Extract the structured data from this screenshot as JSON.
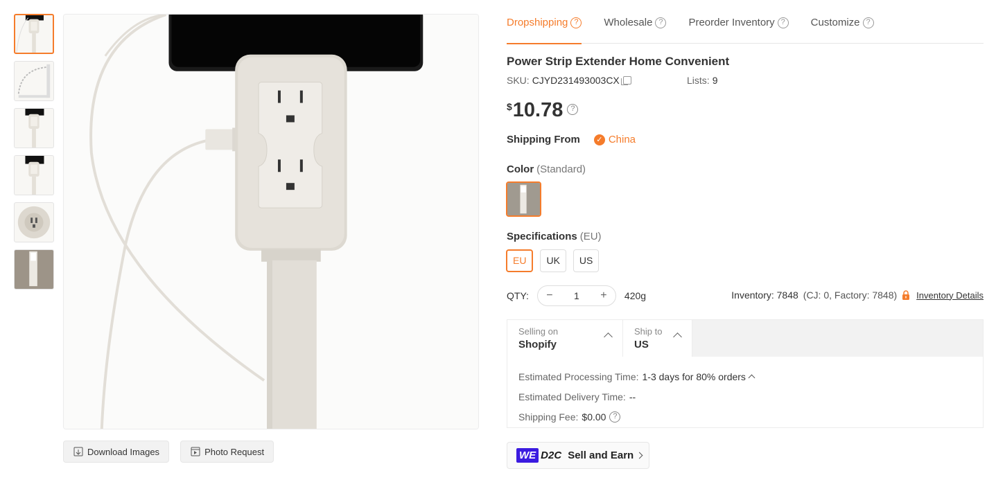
{
  "tabs": [
    {
      "label": "Dropshipping",
      "active": true
    },
    {
      "label": "Wholesale",
      "active": false
    },
    {
      "label": "Preorder Inventory",
      "active": false
    },
    {
      "label": "Customize",
      "active": false
    }
  ],
  "product": {
    "title": "Power Strip Extender Home Convenient",
    "sku_label": "SKU:",
    "sku": "CJYD231493003CX",
    "lists_label": "Lists:",
    "lists": "9",
    "currency": "$",
    "price": "10.78"
  },
  "shipping_from": {
    "label": "Shipping From",
    "country": "China"
  },
  "color": {
    "label": "Color",
    "selected": "(Standard)"
  },
  "specifications": {
    "label": "Specifications",
    "selected": "(EU)",
    "options": [
      "EU",
      "UK",
      "US"
    ]
  },
  "quantity": {
    "label": "QTY:",
    "value": "1",
    "weight": "420g",
    "inventory": "Inventory: 7848",
    "inventory_breakdown": "(CJ: 0, Factory: 7848)",
    "inventory_details": "Inventory Details"
  },
  "shipping": {
    "selling_on_label": "Selling on",
    "selling_on": "Shopify",
    "ship_to_label": "Ship to",
    "ship_to": "US",
    "processing_label": "Estimated Processing Time:",
    "processing": "1-3 days for 80% orders",
    "delivery_label": "Estimated Delivery Time:",
    "delivery": "--",
    "fee_label": "Shipping Fee:",
    "fee": "$0.00"
  },
  "image_actions": {
    "download": "Download Images",
    "photo_request": "Photo Request"
  },
  "promo": {
    "we": "WE",
    "d2c": "D2C",
    "text": "Sell and Earn"
  },
  "colors": {
    "accent": "#f57c2b",
    "brand_we": "#3b1be0"
  },
  "icons": [
    "question-icon",
    "copy-icon",
    "check-icon",
    "lock-icon",
    "download-icon",
    "photo-icon",
    "chevron-up-icon",
    "chevron-right-icon"
  ]
}
